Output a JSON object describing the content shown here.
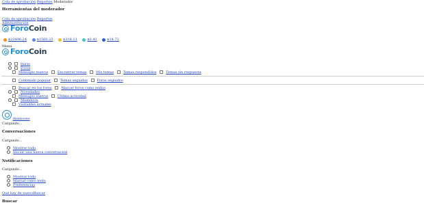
{
  "topbar": {
    "queue_link": "Cola de aprobación",
    "reports_link": "Reportes",
    "moderator": "Moderador"
  },
  "mod_tools": {
    "title": "Herramientas del moderador",
    "queue_link": "Cola de aprobación",
    "reports_link": "Reportes",
    "admin_link": "Administración"
  },
  "logo": {
    "part1": "Foro",
    "part2": "Coin"
  },
  "tickers": [
    {
      "value": "$23496.24",
      "color": "#f7931a"
    },
    {
      "value": "$1560.23",
      "color": "#627eea"
    },
    {
      "value": "$318.11",
      "color": "#f3ba2f"
    },
    {
      "value": "$0.41",
      "color": "#3cc8c8"
    },
    {
      "value": "$14.72",
      "color": "#2a5ada"
    }
  ],
  "menu_label": "Menú",
  "nav": {
    "home": "Inicio",
    "forums": "Foros",
    "forums_sub": [
      "Mensajes nuevos",
      "Encontrar temas",
      "Mis temas",
      "Temas respondidos",
      "Temas sin respuesta"
    ],
    "content_sub": [
      "Contenido popular",
      "Temas seguidos",
      "Foros seguidos"
    ],
    "search_sub": [
      "Buscar en los foros",
      "Marcar foros como leídos"
    ],
    "news": "Novedades",
    "news_sub": [
      "Mensajes nuevos",
      "Última actividad"
    ],
    "members": "Miembros",
    "visitors": "Visitantes actuales"
  },
  "user": {
    "name": "disenoseo"
  },
  "loading1": "Cargando…",
  "conversations": {
    "title": "Conversaciones",
    "loading": "Cargando…",
    "links": [
      "Mostrar todo",
      "Iniciar una nueva conversación"
    ]
  },
  "notifications": {
    "title": "Notificaciones",
    "loading": "Cargando…",
    "links": [
      "Mostrar todo",
      "Marcar como leído",
      "Preferencias"
    ]
  },
  "footer_links": {
    "whats_new": "Qué hay de nuevo",
    "search": "Buscar"
  },
  "search_title": "Buscar"
}
